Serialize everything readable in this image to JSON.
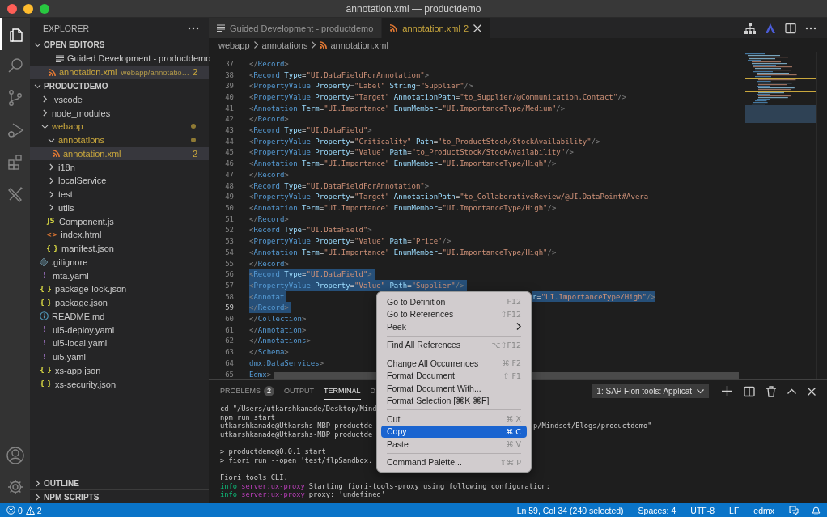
{
  "window": {
    "title": "annotation.xml — productdemo"
  },
  "activity_bar": {
    "top": [
      {
        "kind": "files",
        "selected": true
      },
      {
        "kind": "search",
        "selected": false
      },
      {
        "kind": "source-control",
        "selected": false
      },
      {
        "kind": "run",
        "selected": false
      },
      {
        "kind": "extensions",
        "selected": false
      },
      {
        "kind": "tools",
        "selected": false
      }
    ],
    "bottom": [
      {
        "kind": "account"
      },
      {
        "kind": "settings"
      }
    ]
  },
  "sidebar": {
    "title": "EXPLORER",
    "open_editors": {
      "title": "OPEN EDITORS",
      "expanded": true,
      "items": [
        {
          "label": "Guided Development - productdemo",
          "kind": "preview",
          "selected": false,
          "warning": false
        },
        {
          "label": "annotation.xml",
          "path": "webapp/annotatio…",
          "kind": "xml-file",
          "badge": "2",
          "selected": true,
          "warning": true
        }
      ]
    },
    "project": {
      "title": "PRODUCTDEMO",
      "expanded": true,
      "items": [
        {
          "label": ".vscode",
          "kind": "folder",
          "expanded": false,
          "selected": false,
          "warning": false
        },
        {
          "label": "node_modules",
          "kind": "folder",
          "expanded": false,
          "selected": false,
          "warning": false
        },
        {
          "label": "webapp",
          "kind": "folder",
          "expanded": true,
          "selected": false,
          "warning": true,
          "children": [
            {
              "label": "annotations",
              "kind": "folder",
              "expanded": true,
              "selected": false,
              "warning": true,
              "children": [
                {
                  "label": "annotation.xml",
                  "kind": "xml-file",
                  "badge": "2",
                  "selected": true,
                  "warning": true
                }
              ]
            },
            {
              "label": "i18n",
              "kind": "folder",
              "expanded": false,
              "selected": false,
              "warning": false
            },
            {
              "label": "localService",
              "kind": "folder",
              "expanded": false,
              "selected": false,
              "warning": false
            },
            {
              "label": "test",
              "kind": "folder",
              "expanded": false,
              "selected": false,
              "warning": false
            },
            {
              "label": "utils",
              "kind": "folder",
              "expanded": false,
              "selected": false,
              "warning": false
            },
            {
              "label": "Component.js",
              "kind": "js-file",
              "glyph": "JS",
              "selected": false,
              "warning": false
            },
            {
              "label": "index.html",
              "kind": "html-file",
              "glyph": "<>",
              "selected": false,
              "warning": false
            },
            {
              "label": "manifest.json",
              "kind": "json-file",
              "glyph": "{ }",
              "selected": false,
              "warning": false
            }
          ]
        },
        {
          "label": ".gitignore",
          "kind": "git-file",
          "selected": false,
          "warning": false
        },
        {
          "label": "mta.yaml",
          "kind": "yaml-file",
          "glyph": "!",
          "selected": false,
          "warning": false
        },
        {
          "label": "package-lock.json",
          "kind": "json-file",
          "glyph": "{ }",
          "selected": false,
          "warning": false
        },
        {
          "label": "package.json",
          "kind": "json-file",
          "glyph": "{ }",
          "selected": false,
          "warning": false
        },
        {
          "label": "README.md",
          "kind": "markdown-file",
          "selected": false,
          "warning": false
        },
        {
          "label": "ui5-deploy.yaml",
          "kind": "yaml-file",
          "glyph": "!",
          "selected": false,
          "warning": false
        },
        {
          "label": "ui5-local.yaml",
          "kind": "yaml-file",
          "glyph": "!",
          "selected": false,
          "warning": false
        },
        {
          "label": "ui5.yaml",
          "kind": "yaml-file",
          "glyph": "!",
          "selected": false,
          "warning": false
        },
        {
          "label": "xs-app.json",
          "kind": "json-file",
          "glyph": "{ }",
          "selected": false,
          "warning": false
        },
        {
          "label": "xs-security.json",
          "kind": "json-file",
          "glyph": "{ }",
          "selected": false,
          "warning": false
        }
      ]
    },
    "sections": [
      {
        "title": "OUTLINE",
        "expanded": false
      },
      {
        "title": "NPM SCRIPTS",
        "expanded": false
      }
    ]
  },
  "editor": {
    "tabs": [
      {
        "label": "Guided Development - productdemo",
        "kind": "preview",
        "selected": false,
        "warning": false,
        "closable": false
      },
      {
        "label": "annotation.xml",
        "kind": "xml-file",
        "badge": "2",
        "selected": true,
        "warning": true,
        "closable": true
      }
    ],
    "actions": [
      {
        "kind": "hierarchy"
      },
      {
        "kind": "triangle"
      },
      {
        "kind": "split"
      },
      {
        "kind": "more"
      }
    ],
    "breadcrumbs": [
      {
        "label": "webapp",
        "kind": "folder"
      },
      {
        "label": "annotations",
        "kind": "folder"
      },
      {
        "label": "annotation.xml",
        "kind": "xml-file"
      }
    ],
    "lines": [
      {
        "number": "37",
        "text": "                 </Record>",
        "selected": false,
        "current": false
      },
      {
        "number": "38",
        "text": "                 <Record Type=\"UI.DataFieldForAnnotation\">",
        "selected": false,
        "current": false
      },
      {
        "number": "39",
        "text": "                     <PropertyValue Property=\"Label\" String=\"Supplier\"/>",
        "selected": false,
        "current": false
      },
      {
        "number": "40",
        "text": "                     <PropertyValue Property=\"Target\" AnnotationPath=\"to_Supplier/@Communication.Contact\"/>",
        "selected": false,
        "current": false
      },
      {
        "number": "41",
        "text": "                     <Annotation Term=\"UI.Importance\" EnumMember=\"UI.ImportanceType/Medium\"/>",
        "selected": false,
        "current": false
      },
      {
        "number": "42",
        "text": "                 </Record>",
        "selected": false,
        "current": false
      },
      {
        "number": "43",
        "text": "                 <Record Type=\"UI.DataField\">",
        "selected": false,
        "current": false
      },
      {
        "number": "44",
        "text": "                     <PropertyValue Property=\"Criticality\" Path=\"to_ProductStock/StockAvailability\"/>",
        "selected": false,
        "current": false
      },
      {
        "number": "45",
        "text": "                     <PropertyValue Property=\"Value\" Path=\"to_ProductStock/StockAvailability\"/>",
        "selected": false,
        "current": false
      },
      {
        "number": "46",
        "text": "                     <Annotation Term=\"UI.Importance\" EnumMember=\"UI.ImportanceType/High\"/>",
        "selected": false,
        "current": false
      },
      {
        "number": "47",
        "text": "                 </Record>",
        "selected": false,
        "current": false
      },
      {
        "number": "48",
        "text": "                 <Record Type=\"UI.DataFieldForAnnotation\">",
        "selected": false,
        "current": false
      },
      {
        "number": "49",
        "text": "                     <PropertyValue Property=\"Target\" AnnotationPath=\"to_CollaborativeReview/@UI.DataPoint#Avera",
        "selected": false,
        "current": false
      },
      {
        "number": "50",
        "text": "                     <Annotation Term=\"UI.Importance\" EnumMember=\"UI.ImportanceType/High\"/>",
        "selected": false,
        "current": false
      },
      {
        "number": "51",
        "text": "                 </Record>",
        "selected": false,
        "current": false
      },
      {
        "number": "52",
        "text": "                 <Record Type=\"UI.DataField\">",
        "selected": false,
        "current": false
      },
      {
        "number": "53",
        "text": "                     <PropertyValue Property=\"Value\" Path=\"Price\"/>",
        "selected": false,
        "current": false
      },
      {
        "number": "54",
        "text": "                     <Annotation Term=\"UI.Importance\" EnumMember=\"UI.ImportanceType/High\"/>",
        "selected": false,
        "current": false
      },
      {
        "number": "55",
        "text": "                 </Record>",
        "selected": false,
        "current": false
      },
      {
        "number": "56",
        "text": "                 <Record Type=\"UI.DataField\">",
        "selected": true,
        "current": false
      },
      {
        "number": "57",
        "text": "                     <PropertyValue Property=\"Value\" Path=\"Supplier\"/>",
        "selected": true,
        "current": false
      },
      {
        "number": "58",
        "text": "                     <Annotat",
        "text_after_menu": "r=\"UI.ImportanceType/High\"/>",
        "selected": true,
        "current": false
      },
      {
        "number": "59",
        "text": "                 </Record>",
        "selected": true,
        "current": true
      },
      {
        "number": "60",
        "text": "             </Collection>",
        "selected": false,
        "current": false
      },
      {
        "number": "61",
        "text": "         </Annotation>",
        "selected": false,
        "current": false
      },
      {
        "number": "62",
        "text": "     </Annotations>",
        "selected": false,
        "current": false
      },
      {
        "number": "63",
        "text": " </Schema>",
        "selected": false,
        "current": false
      },
      {
        "number": "64",
        "text": "dmx:DataServices>",
        "selected": false,
        "current": false
      },
      {
        "number": "65",
        "text": "Edmx>",
        "selected": false,
        "current": false
      }
    ]
  },
  "panel": {
    "tabs": [
      {
        "label": "PROBLEMS",
        "badge": "2",
        "selected": false
      },
      {
        "label": "OUTPUT",
        "selected": false
      },
      {
        "label": "TERMINAL",
        "selected": true
      },
      {
        "label": "D",
        "selected": false
      }
    ],
    "terminal_picker": "1: SAP Fiori tools: Applicat",
    "actions": [
      {
        "kind": "add"
      },
      {
        "kind": "split"
      },
      {
        "kind": "trash"
      },
      {
        "kind": "maximize"
      },
      {
        "kind": "close"
      }
    ],
    "lines": [
      {
        "kind": "text",
        "segments": [
          {
            "text": "cd \"/Users/utkarshkanade/Desktop/Mind",
            "kind": "plain"
          }
        ]
      },
      {
        "kind": "text",
        "segments": [
          {
            "text": "npm run start",
            "kind": "plain"
          }
        ]
      },
      {
        "kind": "text",
        "segments": [
          {
            "text": "utkarshkanade@Utkarshs-MBP productde",
            "kind": "plain"
          }
        ],
        "text_after_menu": "p/Mindset/Blogs/productdemo\""
      },
      {
        "kind": "text",
        "segments": [
          {
            "text": "utkarshkanade@Utkarshs-MBP productde",
            "kind": "plain"
          }
        ]
      },
      {
        "kind": "blank"
      },
      {
        "kind": "text",
        "segments": [
          {
            "text": "> productdemo@0.0.1 start",
            "kind": "plain"
          }
        ]
      },
      {
        "kind": "text",
        "segments": [
          {
            "text": "> fiori run --open 'test/flpSandbox.",
            "kind": "plain"
          }
        ]
      },
      {
        "kind": "blank"
      },
      {
        "kind": "text",
        "segments": [
          {
            "text": "Fiori tools CLI.",
            "kind": "plain"
          }
        ]
      },
      {
        "kind": "text",
        "segments": [
          {
            "text": "info",
            "kind": "info"
          },
          {
            "text": " server:ux-proxy",
            "kind": "module"
          },
          {
            "text": " Starting fiori-tools-proxy using following configuration:",
            "kind": "plain"
          }
        ]
      },
      {
        "kind": "text",
        "segments": [
          {
            "text": "info",
            "kind": "info"
          },
          {
            "text": " server:ux-proxy",
            "kind": "module"
          },
          {
            "text": " proxy: 'undefined'",
            "kind": "plain"
          }
        ]
      }
    ]
  },
  "context_menu": {
    "items": [
      {
        "kind": "item",
        "label": "Go to Definition",
        "shortcut": "F12",
        "selected": false
      },
      {
        "kind": "item",
        "label": "Go to References",
        "shortcut": "⇧F12",
        "selected": false
      },
      {
        "kind": "submenu",
        "label": "Peek",
        "selected": false
      },
      {
        "kind": "separator"
      },
      {
        "kind": "item",
        "label": "Find All References",
        "shortcut": "⌥⇧F12",
        "selected": false
      },
      {
        "kind": "separator"
      },
      {
        "kind": "item",
        "label": "Change All Occurrences",
        "shortcut": "⌘ F2",
        "selected": false
      },
      {
        "kind": "item",
        "label": "Format Document",
        "shortcut": "⇧ F1",
        "selected": false
      },
      {
        "kind": "item",
        "label": "Format Document With...",
        "selected": false
      },
      {
        "kind": "item",
        "label": "Format Selection [⌘K ⌘F]",
        "selected": false
      },
      {
        "kind": "separator"
      },
      {
        "kind": "item",
        "label": "Cut",
        "shortcut": "⌘ X",
        "selected": false
      },
      {
        "kind": "item",
        "label": "Copy",
        "shortcut": "⌘ C",
        "selected": true
      },
      {
        "kind": "item",
        "label": "Paste",
        "shortcut": "⌘ V",
        "selected": false
      },
      {
        "kind": "separator"
      },
      {
        "kind": "item",
        "label": "Command Palette...",
        "shortcut": "⇧⌘ P",
        "selected": false
      }
    ]
  },
  "status_bar": {
    "errors": "0",
    "warnings": "2",
    "items": [
      "Ln 59, Col 34 (240 selected)",
      "Spaces: 4",
      "UTF-8",
      "LF",
      "edmx"
    ]
  }
}
